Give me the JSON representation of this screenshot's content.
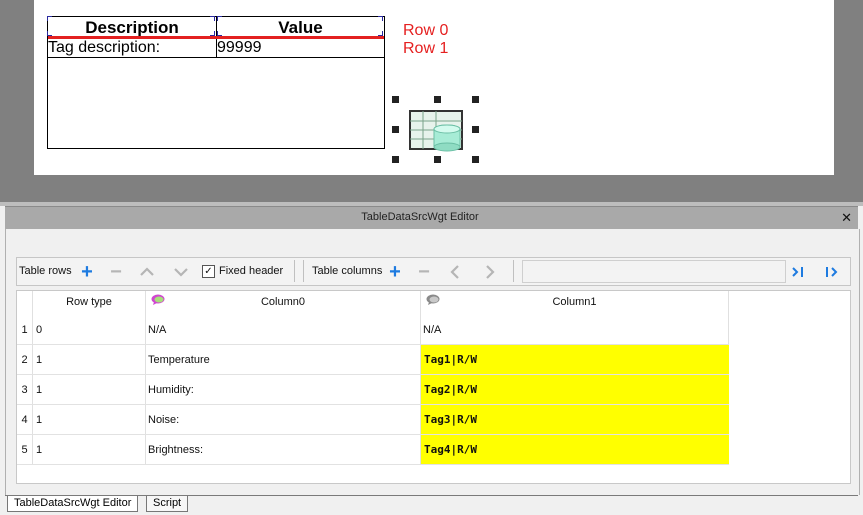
{
  "preview": {
    "headers": [
      "Description",
      "Value"
    ],
    "row": [
      "Tag description:",
      "99999"
    ],
    "row_labels": [
      "Row 0",
      "Row 1"
    ]
  },
  "editor": {
    "title": "TableDataSrcWgt Editor",
    "close_label": "✕"
  },
  "toolbar": {
    "table_rows_label": "Table rows",
    "fixed_header_label": "Fixed header",
    "fixed_header_checked": "✓",
    "table_columns_label": "Table columns"
  },
  "grid": {
    "headers": [
      "Row type",
      "Column0",
      "Column1"
    ],
    "rows": [
      {
        "num": "1",
        "type": "0",
        "col0": "N/A",
        "col1": "N/A",
        "highlight": false
      },
      {
        "num": "2",
        "type": "1",
        "col0": "Temperature",
        "col1": "Tag1|R/W",
        "highlight": true
      },
      {
        "num": "3",
        "type": "1",
        "col0": "Humidity:",
        "col1": "Tag2|R/W",
        "highlight": true
      },
      {
        "num": "4",
        "type": "1",
        "col0": "Noise:",
        "col1": "Tag3|R/W",
        "highlight": true
      },
      {
        "num": "5",
        "type": "1",
        "col0": "Brightness:",
        "col1": "Tag4|R/W",
        "highlight": true
      }
    ],
    "highlight_color": "#ffff00"
  },
  "tabs": [
    "TableDataSrcWgt Editor",
    "Script"
  ],
  "colors": {
    "accent": "#1e7be0",
    "row_label": "#e52020"
  },
  "icons": {
    "add": "plus-icon",
    "remove": "minus-icon",
    "move_up": "chevron-up-icon",
    "move_down": "chevron-down-icon",
    "move_left": "chevron-left-icon",
    "move_right": "chevron-right-icon",
    "comment": "speech-bubble-icon",
    "widget": "table-datasource-icon"
  }
}
